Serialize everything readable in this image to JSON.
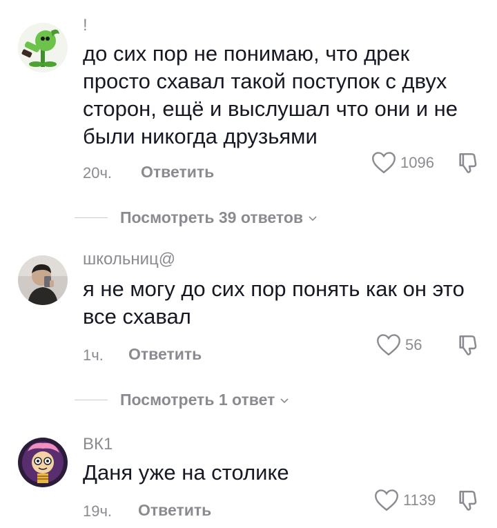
{
  "comments": [
    {
      "username": "!",
      "text": "до сих пор не понимаю, что дрек\nпросто схавал такой поступок с двух\nсторон, ещё и выслушал что они и не\nбыли никогда друзьями",
      "time": "20ч.",
      "reply_label": "Ответить",
      "likes": "1096",
      "avatar_icon": "peashooter-plant-icon",
      "view_replies": "Посмотреть 39 ответов"
    },
    {
      "username": "школьниц@",
      "text": "я не могу до сих пор понять как он это\nвсе схавал",
      "time": "1ч.",
      "reply_label": "Ответить",
      "likes": "56",
      "avatar_icon": "person-photo-avatar",
      "view_replies": "Посмотреть 1 ответ"
    },
    {
      "username": "ВК1",
      "text": "Даня уже на столике",
      "time": "19ч.",
      "reply_label": "Ответить",
      "likes": "1139",
      "avatar_icon": "cartoon-character-avatar"
    }
  ],
  "colors": {
    "text": "#161823",
    "muted": "#8a8b91",
    "divider": "#c8c9cc"
  }
}
